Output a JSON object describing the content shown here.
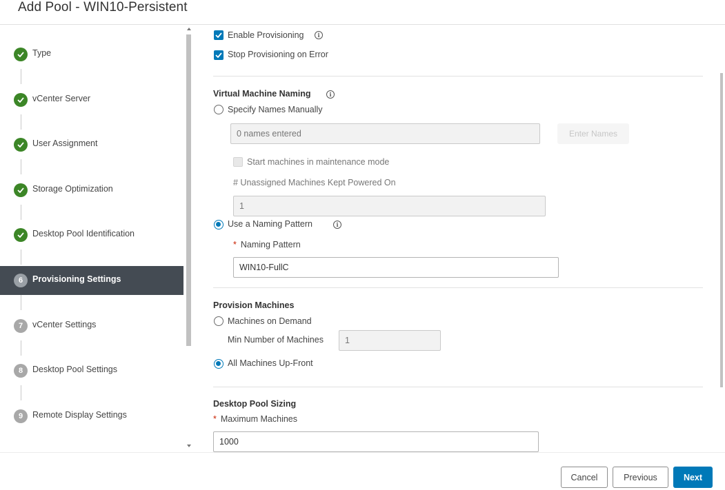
{
  "title": "Add Pool - WIN10-Persistent",
  "steps": [
    {
      "num": "1",
      "label": "Type",
      "state": "done"
    },
    {
      "num": "2",
      "label": "vCenter Server",
      "state": "done"
    },
    {
      "num": "3",
      "label": "User Assignment",
      "state": "done"
    },
    {
      "num": "4",
      "label": "Storage Optimization",
      "state": "done"
    },
    {
      "num": "5",
      "label": "Desktop Pool Identification",
      "state": "done"
    },
    {
      "num": "6",
      "label": "Provisioning Settings",
      "state": "current"
    },
    {
      "num": "7",
      "label": "vCenter Settings",
      "state": "todo"
    },
    {
      "num": "8",
      "label": "Desktop Pool Settings",
      "state": "todo"
    },
    {
      "num": "9",
      "label": "Remote Display Settings",
      "state": "todo"
    }
  ],
  "provisioning": {
    "enable_label": "Enable Provisioning",
    "enable_checked": true,
    "stop_label": "Stop Provisioning on Error",
    "stop_checked": true
  },
  "naming": {
    "heading": "Virtual Machine Naming",
    "manual_label": "Specify Names Manually",
    "names_value": "0 names entered",
    "enter_names_label": "Enter Names",
    "maintenance_label": "Start machines in maintenance mode",
    "unassigned_label": "# Unassigned Machines Kept Powered On",
    "unassigned_value": "1",
    "pattern_option_label": "Use a Naming Pattern",
    "pattern_field_label": "Naming Pattern",
    "required_mark": "*",
    "pattern_value": "WIN10-FullC",
    "selected": "pattern"
  },
  "provision_machines": {
    "heading": "Provision Machines",
    "on_demand_label": "Machines on Demand",
    "min_label": "Min Number of Machines",
    "min_value": "1",
    "upfront_label": "All Machines Up-Front",
    "selected": "upfront"
  },
  "sizing": {
    "heading": "Desktop Pool Sizing",
    "max_label": "Maximum Machines",
    "required_mark": "*",
    "max_value": "1000"
  },
  "info_glyph": "i",
  "footer": {
    "cancel": "Cancel",
    "previous": "Previous",
    "next": "Next"
  },
  "colors": {
    "accent": "#0079b8",
    "done": "#3c8627",
    "current_bg": "#444b53"
  }
}
